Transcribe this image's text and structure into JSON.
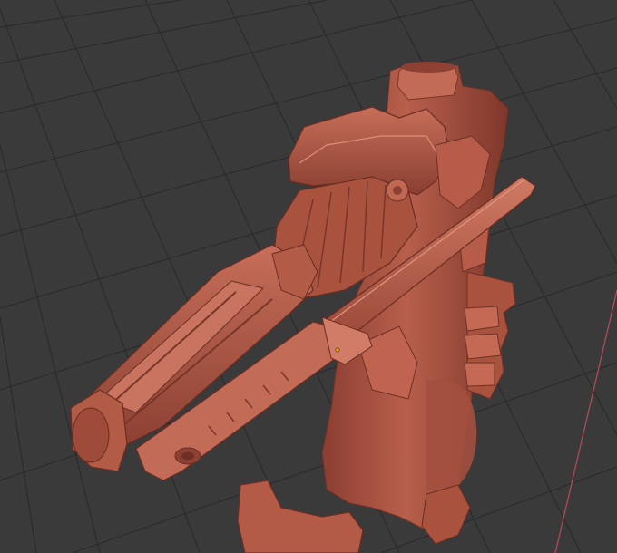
{
  "viewport": {
    "background": "#3a3a3a",
    "grid_line_color": "#2b2b2b",
    "grid_visible": true,
    "x_axis_color": "#b04a58",
    "object_name_icon": "sculpt-model",
    "model_color": "#b4604f",
    "model_shadow_color": "#7c3a2f",
    "model_highlight_color": "#d9846f",
    "origin_marker_color": "#e0a020"
  }
}
